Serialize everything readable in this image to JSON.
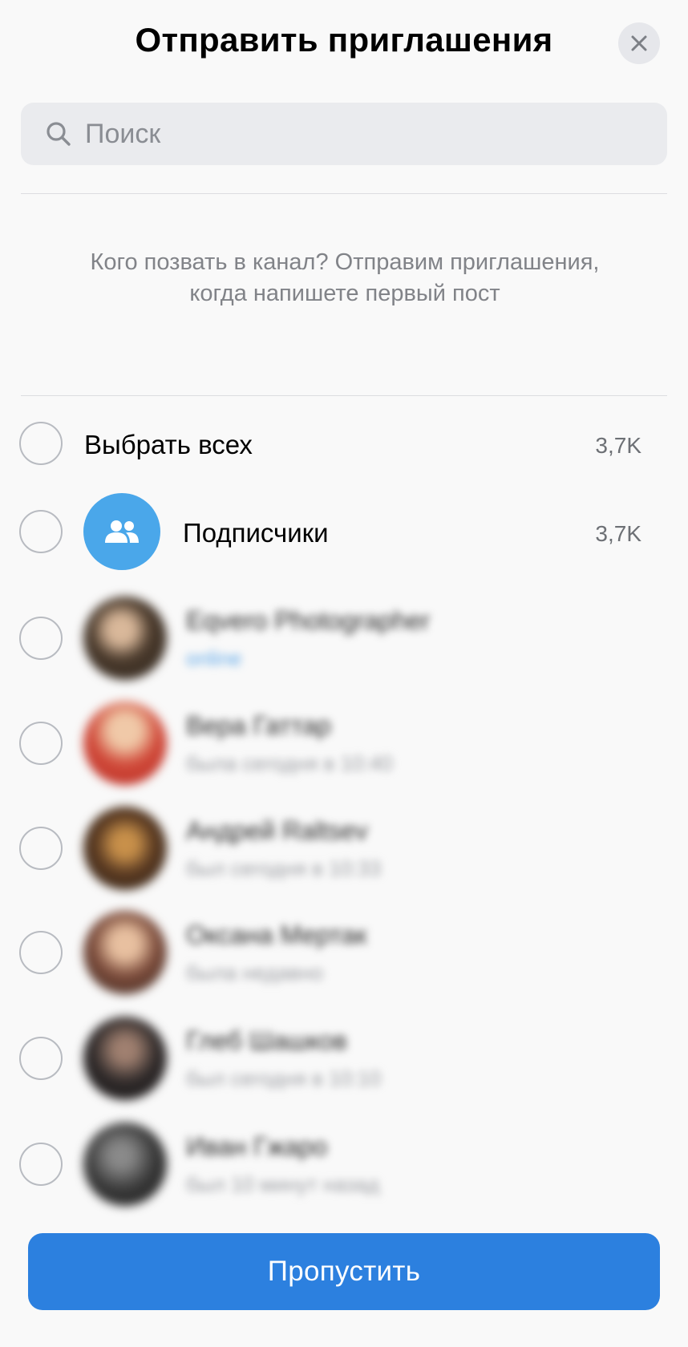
{
  "header": {
    "title": "Отправить приглашения"
  },
  "search": {
    "placeholder": "Поиск",
    "value": ""
  },
  "info_text": "Кого позвать в канал? Отправим приглашения, когда напишете первый пост",
  "select_all": {
    "label": "Выбрать всех",
    "count": "3,7K"
  },
  "subscribers": {
    "label": "Подписчики",
    "count": "3,7K"
  },
  "contacts": [
    {
      "name": "Eqvero Photographer",
      "status": "online",
      "avatar_color": "#4a3a2c"
    },
    {
      "name": "Вера Гаттар",
      "status": "была сегодня в 10:40",
      "avatar_color": "#c04a3a"
    },
    {
      "name": "Андрей Raltsev",
      "status": "был сегодня в 10:33",
      "avatar_color": "#5a3a22"
    },
    {
      "name": "Оксана Мертак",
      "status": "была недавно",
      "avatar_color": "#6a4a3a"
    },
    {
      "name": "Глеб Шашков",
      "status": "был сегодня в 10:10",
      "avatar_color": "#2f2a2a"
    },
    {
      "name": "Иван Гжаро",
      "status": "был 10 минут назад",
      "avatar_color": "#3a3a3a"
    }
  ],
  "footer": {
    "skip_label": "Пропустить"
  },
  "colors": {
    "accent": "#2c80df",
    "group_avatar": "#4aa7ea"
  }
}
